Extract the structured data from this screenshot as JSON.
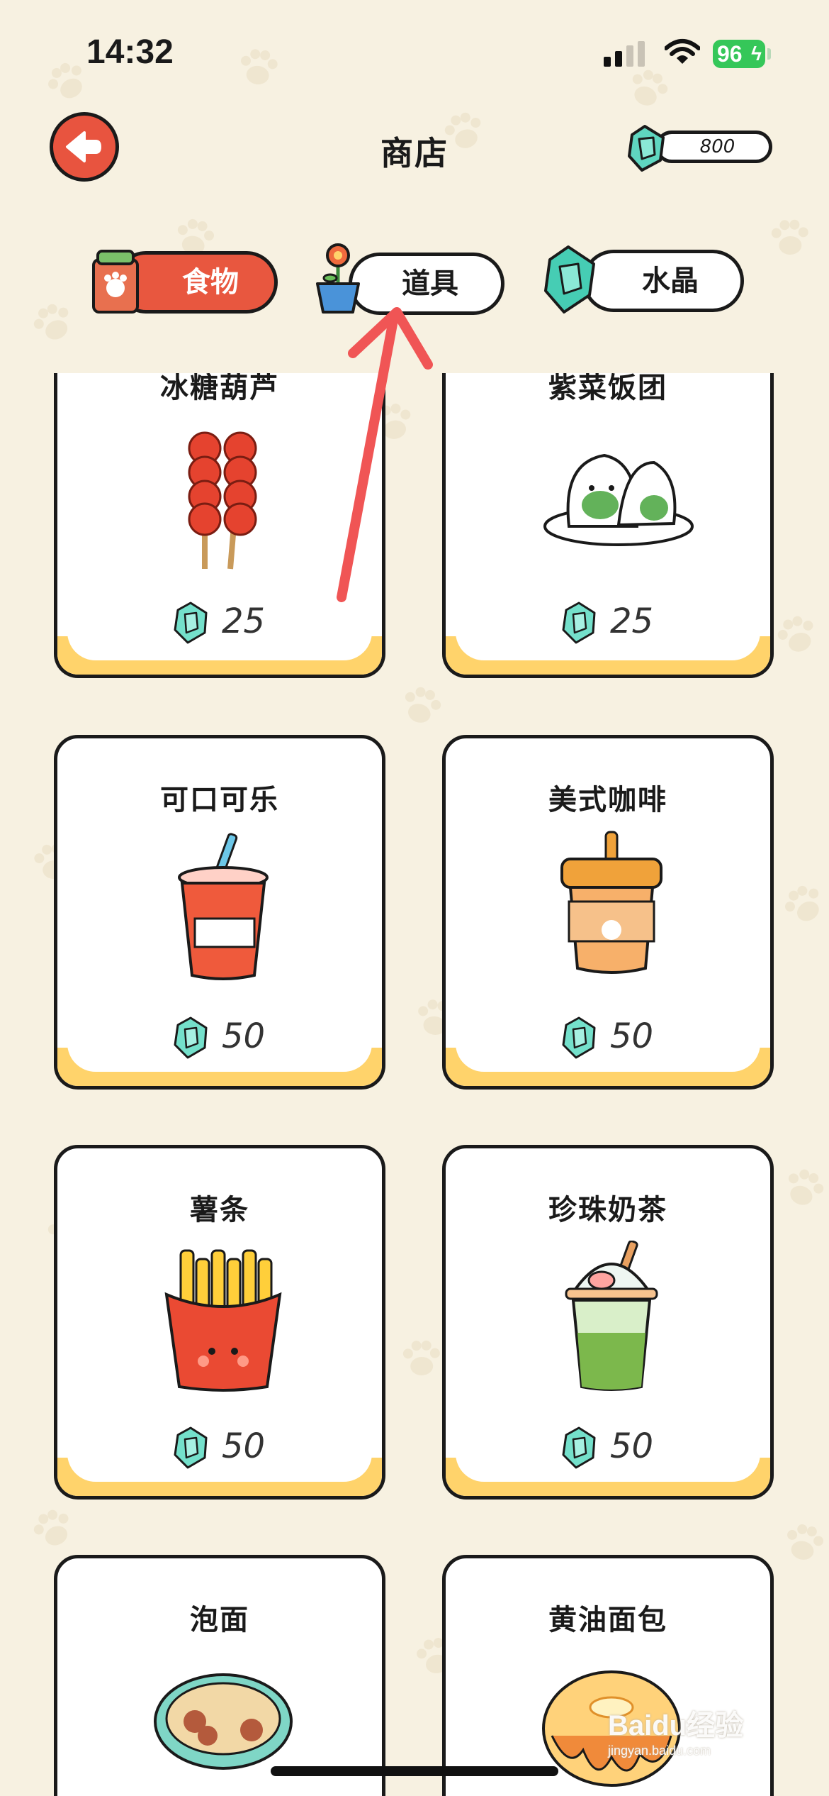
{
  "status_bar": {
    "time": "14:32",
    "battery": "96"
  },
  "header": {
    "title": "商店",
    "crystal_count": "800"
  },
  "tabs": [
    {
      "label": "食物",
      "icon": "food-bag-icon",
      "active": true
    },
    {
      "label": "道具",
      "icon": "flower-pot-icon",
      "active": false
    },
    {
      "label": "水晶",
      "icon": "crystal-icon",
      "active": false
    }
  ],
  "items": [
    {
      "name": "冰糖葫芦",
      "price": "25",
      "icon": "candied-haws-icon"
    },
    {
      "name": "紫菜饭团",
      "price": "25",
      "icon": "rice-ball-icon"
    },
    {
      "name": "可口可乐",
      "price": "50",
      "icon": "cola-cup-icon"
    },
    {
      "name": "美式咖啡",
      "price": "50",
      "icon": "coffee-cup-icon"
    },
    {
      "name": "薯条",
      "price": "50",
      "icon": "french-fries-icon"
    },
    {
      "name": "珍珠奶茶",
      "price": "50",
      "icon": "bubble-tea-icon"
    },
    {
      "name": "泡面",
      "price": "",
      "icon": "instant-noodles-icon"
    },
    {
      "name": "黄油面包",
      "price": "",
      "icon": "butter-bread-icon"
    }
  ],
  "watermark": {
    "brand": "Baidu经验",
    "url": "jingyan.baidu.com"
  },
  "colors": {
    "background": "#f7f1e1",
    "accent": "#e8573f",
    "card_base": "#ffd36b",
    "crystal": "#5fd6c0",
    "annotation": "#f05555"
  }
}
